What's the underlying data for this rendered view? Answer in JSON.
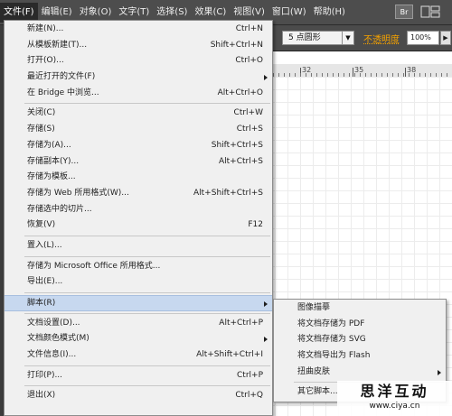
{
  "menubar": {
    "items": [
      {
        "label": "文件(F)",
        "active": true
      },
      {
        "label": "编辑(E)"
      },
      {
        "label": "对象(O)"
      },
      {
        "label": "文字(T)"
      },
      {
        "label": "选择(S)"
      },
      {
        "label": "效果(C)"
      },
      {
        "label": "视图(V)"
      },
      {
        "label": "窗口(W)"
      },
      {
        "label": "帮助(H)"
      }
    ],
    "bridge_label": "Br",
    "workspace_icon": "workspace-grid-icon"
  },
  "controlbar": {
    "brush_value": "5 点圆形",
    "opacity_label": "不透明度",
    "opacity_value": "100%"
  },
  "ruler": {
    "labels": [
      "32",
      "35",
      "38"
    ]
  },
  "file_menu": {
    "groups": [
      [
        {
          "label": "新建(N)...",
          "shortcut": "Ctrl+N"
        },
        {
          "label": "从模板新建(T)...",
          "shortcut": "Shift+Ctrl+N"
        },
        {
          "label": "打开(O)...",
          "shortcut": "Ctrl+O"
        },
        {
          "label": "最近打开的文件(F)",
          "shortcut": "",
          "submenu": true
        },
        {
          "label": "在 Bridge 中浏览...",
          "shortcut": "Alt+Ctrl+O"
        }
      ],
      [
        {
          "label": "关闭(C)",
          "shortcut": "Ctrl+W"
        },
        {
          "label": "存储(S)",
          "shortcut": "Ctrl+S"
        },
        {
          "label": "存储为(A)...",
          "shortcut": "Shift+Ctrl+S"
        },
        {
          "label": "存储副本(Y)...",
          "shortcut": "Alt+Ctrl+S"
        },
        {
          "label": "存储为模板...",
          "shortcut": ""
        },
        {
          "label": "存储为 Web 所用格式(W)...",
          "shortcut": "Alt+Shift+Ctrl+S"
        },
        {
          "label": "存储选中的切片...",
          "shortcut": ""
        },
        {
          "label": "恢复(V)",
          "shortcut": "F12"
        }
      ],
      [
        {
          "label": "置入(L)...",
          "shortcut": ""
        }
      ],
      [
        {
          "label": "存储为 Microsoft Office 所用格式...",
          "shortcut": ""
        },
        {
          "label": "导出(E)...",
          "shortcut": ""
        }
      ],
      [
        {
          "label": "脚本(R)",
          "shortcut": "",
          "submenu": true,
          "highlighted": true
        }
      ],
      [
        {
          "label": "文档设置(D)...",
          "shortcut": "Alt+Ctrl+P"
        },
        {
          "label": "文档颜色模式(M)",
          "shortcut": "",
          "submenu": true
        },
        {
          "label": "文件信息(I)...",
          "shortcut": "Alt+Shift+Ctrl+I"
        }
      ],
      [
        {
          "label": "打印(P)...",
          "shortcut": "Ctrl+P"
        }
      ],
      [
        {
          "label": "退出(X)",
          "shortcut": "Ctrl+Q"
        }
      ]
    ]
  },
  "scripts_submenu": {
    "groups": [
      [
        {
          "label": "图像描摹"
        },
        {
          "label": "将文档存储为 PDF"
        },
        {
          "label": "将文档存储为 SVG"
        },
        {
          "label": "将文档导出为 Flash"
        },
        {
          "label": "扭曲皮肤",
          "submenu": true
        }
      ],
      [
        {
          "label": "其它脚本..."
        }
      ]
    ]
  },
  "watermark": {
    "title": "思洋互动",
    "url": "www.ciya.cn"
  }
}
